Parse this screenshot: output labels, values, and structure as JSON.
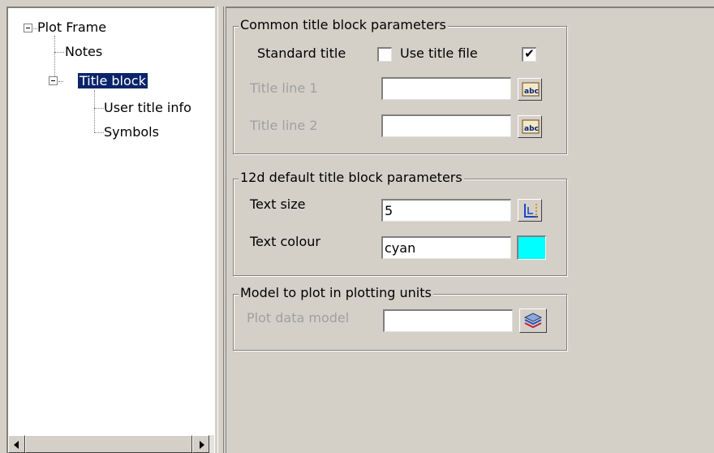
{
  "tree": {
    "root": "Plot Frame",
    "notes": "Notes",
    "title_block": "Title block",
    "user_title_info": "User title info",
    "symbols": "Symbols"
  },
  "common_group": {
    "title": "Common title block parameters",
    "standard_title_label": "Standard title",
    "standard_title_checked": false,
    "use_title_file_label": "Use title file",
    "use_title_file_checked": true,
    "title_line_1_label": "Title line 1",
    "title_line_1_value": "",
    "title_line_2_label": "Title line 2",
    "title_line_2_value": ""
  },
  "default_group": {
    "title": "12d default title block parameters",
    "text_size_label": "Text size",
    "text_size_value": "5",
    "text_colour_label": "Text colour",
    "text_colour_value": "cyan",
    "swatch_color": "#00ffff"
  },
  "model_group": {
    "title": "Model to plot in plotting units",
    "plot_data_model_label": "Plot data model",
    "plot_data_model_value": ""
  },
  "icons": {
    "text_edit": "abc-text-icon",
    "text_size": "text-size-icon",
    "model": "layers-icon"
  }
}
